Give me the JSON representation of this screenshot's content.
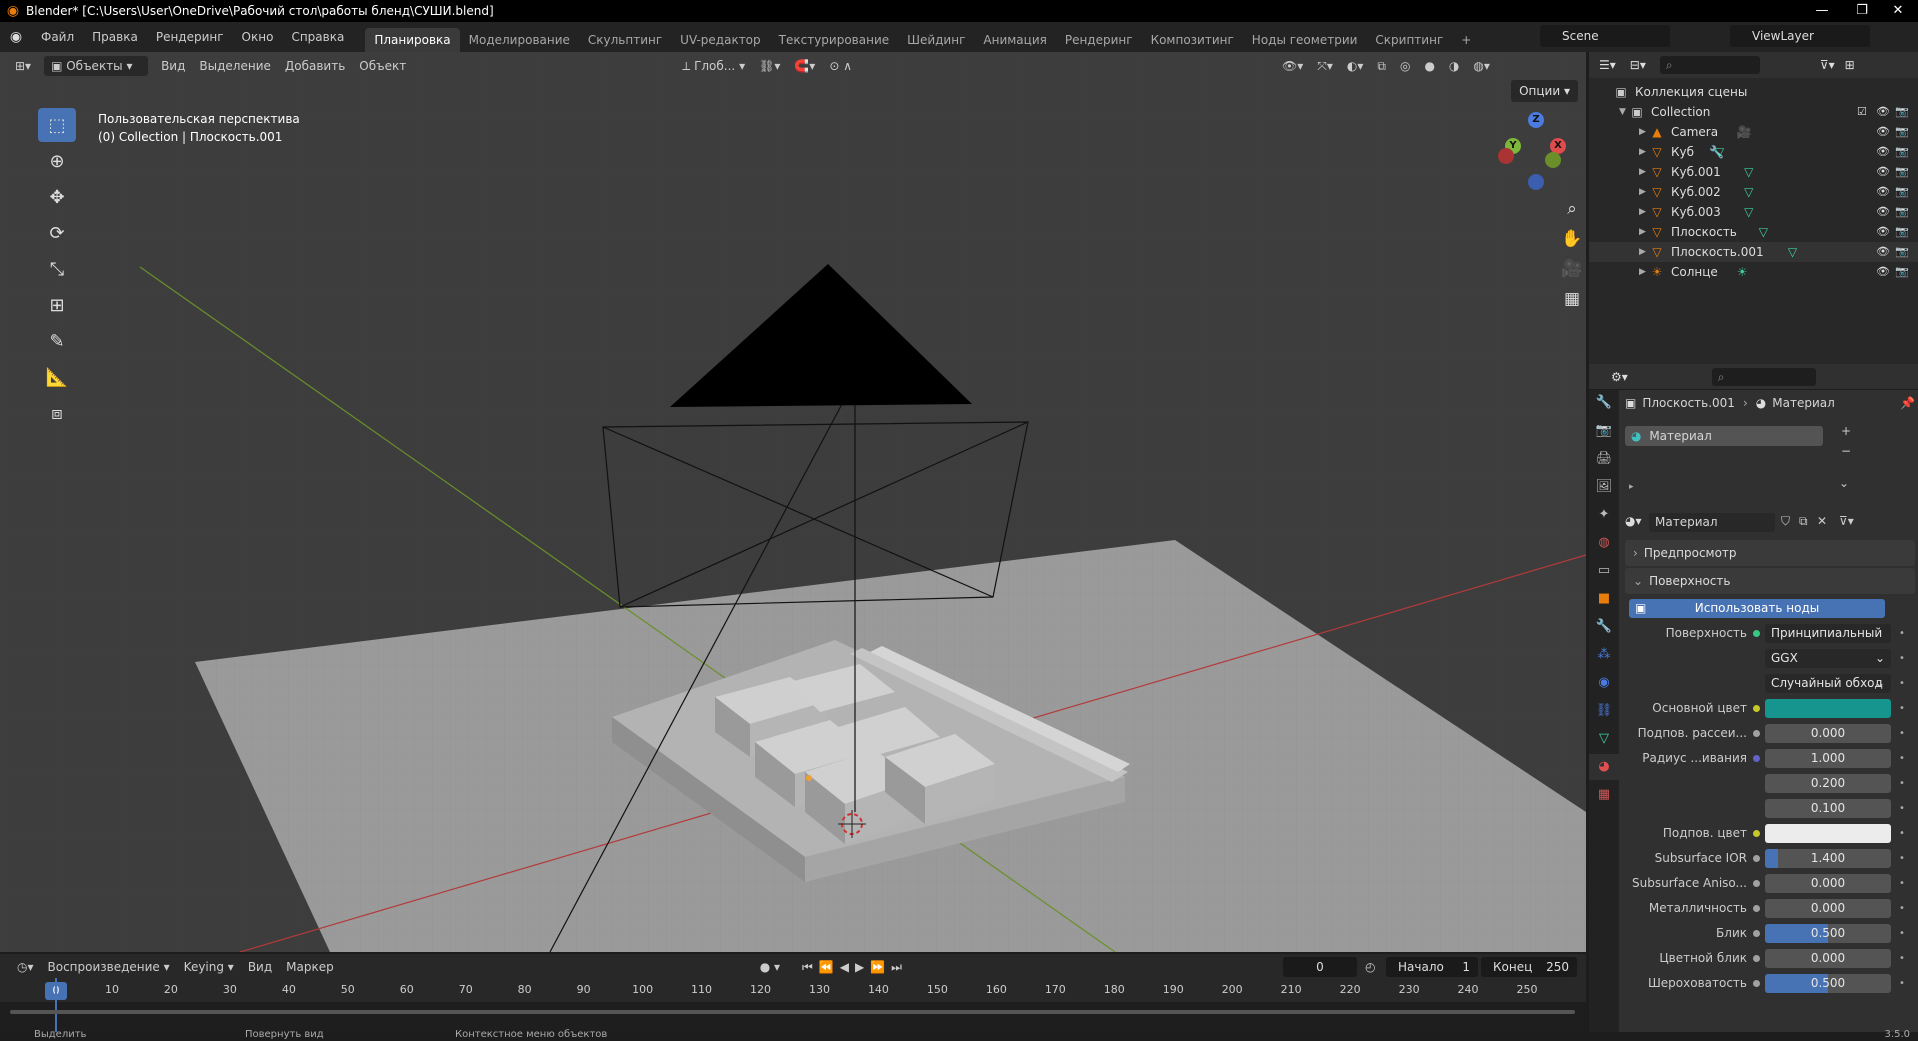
{
  "window": {
    "title": "Blender* [C:\\Users\\User\\OneDrive\\Рабочий стол\\работы бленд\\СУШИ.blend]",
    "controls": [
      "—",
      "❐",
      "✕"
    ]
  },
  "menu": [
    "Файл",
    "Правка",
    "Рендеринг",
    "Окно",
    "Справка"
  ],
  "workspaces": [
    {
      "label": "Планировка",
      "active": true
    },
    {
      "label": "Моделирование"
    },
    {
      "label": "Скульптинг"
    },
    {
      "label": "UV-редактор"
    },
    {
      "label": "Текстурирование"
    },
    {
      "label": "Шейдинг"
    },
    {
      "label": "Анимация"
    },
    {
      "label": "Рендеринг"
    },
    {
      "label": "Композитинг"
    },
    {
      "label": "Ноды геометрии"
    },
    {
      "label": "Скриптинг"
    }
  ],
  "add_workspace": "+",
  "scene": {
    "name": "Scene",
    "view_layer": "ViewLayer"
  },
  "viewport": {
    "mode": "Объекты",
    "menus": [
      "Вид",
      "Выделение",
      "Добавить",
      "Объект"
    ],
    "orientation": "Глоб...",
    "options": "Опции",
    "info_line1": "Пользовательская перспектива",
    "info_line2": "(0) Collection | Плоскость.001",
    "gizmo": {
      "x": "X",
      "y": "Y",
      "z": "Z"
    }
  },
  "outliner": {
    "root": "Коллекция сцены",
    "collection": "Collection",
    "items": [
      {
        "name": "Camera",
        "type": "camera"
      },
      {
        "name": "Куб",
        "type": "mesh"
      },
      {
        "name": "Куб.001",
        "type": "mesh"
      },
      {
        "name": "Куб.002",
        "type": "mesh"
      },
      {
        "name": "Куб.003",
        "type": "mesh"
      },
      {
        "name": "Плоскость",
        "type": "mesh"
      },
      {
        "name": "Плоскость.001",
        "type": "mesh"
      },
      {
        "name": "Солнце",
        "type": "light"
      }
    ]
  },
  "properties": {
    "breadcrumb_object": "Плоскость.001",
    "breadcrumb_material": "Материал",
    "slot_name": "Материал",
    "material_name": "Материал",
    "section_preview": "Предпросмотр",
    "section_surface": "Поверхность",
    "use_nodes": "Использовать ноды",
    "rows": [
      {
        "label": "Поверхность",
        "value": "Принципиальный BS...",
        "dot": "green",
        "kind": "dark"
      },
      {
        "label": "",
        "value": "GGX",
        "dot": "",
        "kind": "dark"
      },
      {
        "label": "",
        "value": "Случайный обход",
        "dot": "",
        "kind": "dark"
      },
      {
        "label": "Основной цвет",
        "value": "",
        "dot": "yellow",
        "kind": "color",
        "color": "#16958f"
      },
      {
        "label": "Подпов. рассеи...",
        "value": "0.000",
        "dot": "gray",
        "kind": "num"
      },
      {
        "label": "Радиус ...ивания",
        "value": "1.000",
        "dot": "blue",
        "kind": "num"
      },
      {
        "label": "",
        "value": "0.200",
        "dot": "",
        "kind": "num"
      },
      {
        "label": "",
        "value": "0.100",
        "dot": "",
        "kind": "num"
      },
      {
        "label": "Подпов. цвет",
        "value": "",
        "dot": "yellow",
        "kind": "color",
        "color": "#ececec"
      },
      {
        "label": "Subsurface IOR",
        "value": "1.400",
        "dot": "gray",
        "kind": "slider",
        "fill": 0.1
      },
      {
        "label": "Subsurface Aniso...",
        "value": "0.000",
        "dot": "gray",
        "kind": "num"
      },
      {
        "label": "Металличность",
        "value": "0.000",
        "dot": "gray",
        "kind": "num"
      },
      {
        "label": "Блик",
        "value": "0.500",
        "dot": "gray",
        "kind": "slider",
        "fill": 0.5
      },
      {
        "label": "Цветной блик",
        "value": "0.000",
        "dot": "gray",
        "kind": "num"
      },
      {
        "label": "Шероховатость",
        "value": "0.500",
        "dot": "gray",
        "kind": "slider",
        "fill": 0.5
      }
    ]
  },
  "timeline": {
    "menus": [
      "Воспроизведение",
      "Keying",
      "Вид",
      "Маркер"
    ],
    "current_frame": "0",
    "start_label": "Начало",
    "start": "1",
    "end_label": "Конец",
    "end": "250",
    "ticks": [
      "0",
      "10",
      "20",
      "30",
      "40",
      "50",
      "60",
      "70",
      "80",
      "90",
      "100",
      "110",
      "120",
      "130",
      "140",
      "150",
      "160",
      "170",
      "180",
      "190",
      "200",
      "210",
      "220",
      "230",
      "240",
      "250"
    ]
  },
  "status": {
    "left": "Выделить",
    "middle": "Повернуть вид",
    "right": "Контекстное меню объектов",
    "version": "3.5.0"
  }
}
